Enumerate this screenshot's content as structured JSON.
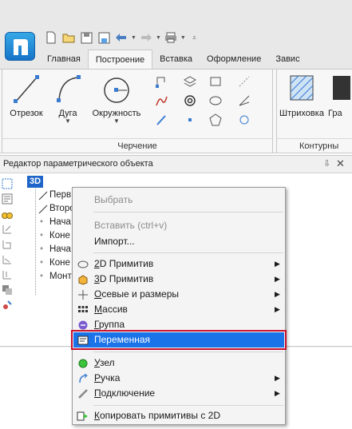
{
  "ribbon_tabs": [
    "Главная",
    "Построение",
    "Вставка",
    "Оформление",
    "Завис"
  ],
  "active_tab_index": 1,
  "drawing_group": {
    "title": "Черчение",
    "segment_label": "Отрезок",
    "arc_label": "Дуга",
    "circle_label": "Окружность"
  },
  "contour_group": {
    "title": "Контурны",
    "hatch_label": "Штриховка",
    "next_label": "Гра"
  },
  "panel": {
    "title": "Редактор параметрического объекта",
    "pin_icon": "⇩",
    "close_icon": "✕"
  },
  "tree": {
    "root": "3D",
    "items": [
      "Перв",
      "Второ",
      "Нача",
      "Коне",
      "Нача",
      "Коне",
      "Монт"
    ]
  },
  "context_menu": {
    "select": "Выбрать",
    "paste": "Вставить (ctrl+v)",
    "import": "Импорт...",
    "primitives_2d": "2D Примитив",
    "primitives_3d": "3D Примитив",
    "axial_dims": "Осевые и размеры",
    "array": "Массив",
    "group": "Группа",
    "variable": "Переменная",
    "node": "Узел",
    "handle": "Ручка",
    "connection": "Подключение",
    "copy_2d": "Копировать примитивы с 2D"
  },
  "accent_colors": {
    "highlight": "#1a73e8",
    "highlight_border": "#c8102e",
    "root_badge": "#1f64c8"
  }
}
